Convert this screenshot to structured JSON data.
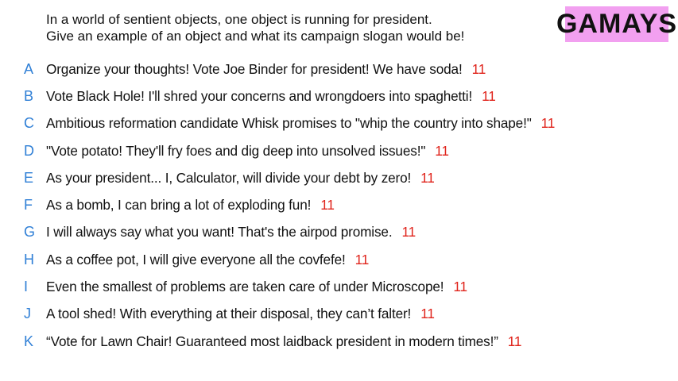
{
  "prompt": {
    "line1": "In a world of sentient objects, one object is running for president.",
    "line2": "Give an example of an object and what its campaign slogan would be!"
  },
  "badge": {
    "label": "GAMAYS",
    "color": "#f2a0f0"
  },
  "colors": {
    "letter": "#2f7fd6",
    "score": "#e0241c",
    "text": "#111111"
  },
  "answers": [
    {
      "letter": "A",
      "text": "Organize your thoughts! Vote Joe Binder for president! We have soda!",
      "score": "11"
    },
    {
      "letter": "B",
      "text": "Vote Black Hole! I'll shred your concerns and wrongdoers into spaghetti!",
      "score": "11"
    },
    {
      "letter": "C",
      "text": "Ambitious reformation candidate Whisk promises to \"whip the country into shape!\"",
      "score": "11"
    },
    {
      "letter": "D",
      "text": "\"Vote potato! They'll fry foes and dig deep into unsolved issues!\"",
      "score": "11"
    },
    {
      "letter": "E",
      "text": "As your president... I, Calculator, will divide your debt by zero!",
      "score": "11"
    },
    {
      "letter": "F",
      "text": "As a bomb, I can bring a lot of exploding fun!",
      "score": "11"
    },
    {
      "letter": "G",
      "text": "I will always say what you want! That's the airpod promise.",
      "score": "11"
    },
    {
      "letter": "H",
      "text": "As a coffee pot, I will give everyone all the covfefe!",
      "score": "11"
    },
    {
      "letter": "I",
      "text": "Even the smallest of problems are taken care of under Microscope!",
      "score": "11"
    },
    {
      "letter": "J",
      "text": "A tool shed! With everything at their disposal, they can’t falter!",
      "score": "11"
    },
    {
      "letter": "K",
      "text": "“Vote for Lawn Chair! Guaranteed most laidback president in modern times!”",
      "score": "11"
    }
  ]
}
